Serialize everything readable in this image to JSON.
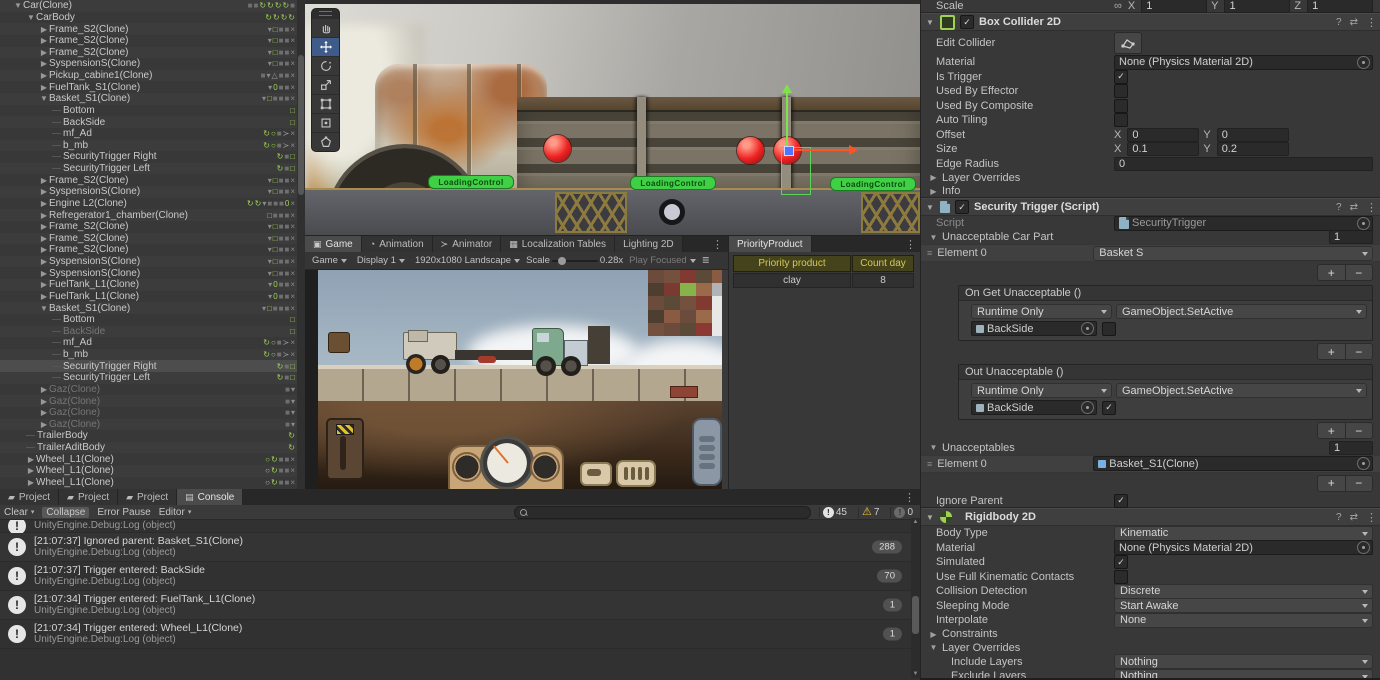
{
  "hierarchy": {
    "items": [
      {
        "label": "Car(Clone)",
        "depth": 1,
        "arrow": "open",
        "state": "normal",
        "badges": [
          "dsq",
          "dsq",
          "gref",
          "gref",
          "gref",
          "gref",
          "dsq"
        ]
      },
      {
        "label": "CarBody",
        "depth": 2,
        "arrow": "open",
        "state": "normal",
        "badges": [
          "gref",
          "gref",
          "gref",
          "gref"
        ]
      },
      {
        "label": "Frame_S2(Clone)",
        "depth": 3,
        "arrow": "closed",
        "state": "normal",
        "badges": [
          "chev",
          "gsq",
          "dsq",
          "dsq",
          "x"
        ]
      },
      {
        "label": "Frame_S2(Clone)",
        "depth": 3,
        "arrow": "closed",
        "state": "normal",
        "badges": [
          "chev",
          "gsq",
          "dsq",
          "dsq",
          "x"
        ]
      },
      {
        "label": "Frame_S2(Clone)",
        "depth": 3,
        "arrow": "closed",
        "state": "normal",
        "badges": [
          "chev",
          "gsq",
          "dsq",
          "dsq",
          "x"
        ]
      },
      {
        "label": "SyspensionS(Clone)",
        "depth": 3,
        "arrow": "closed",
        "state": "normal",
        "badges": [
          "chev",
          "gsq",
          "dsq",
          "dsq",
          "x"
        ]
      },
      {
        "label": "Pickup_cabine1(Clone)",
        "depth": 3,
        "arrow": "closed",
        "state": "normal",
        "badges": [
          "dsq",
          "chev",
          "tri",
          "dsq",
          "dsq",
          "x"
        ]
      },
      {
        "label": "FuelTank_S1(Clone)",
        "depth": 3,
        "arrow": "closed",
        "state": "normal",
        "badges": [
          "chev",
          "gzero",
          "dsq",
          "dsq",
          "x"
        ]
      },
      {
        "label": "Basket_S1(Clone)",
        "depth": 3,
        "arrow": "open",
        "state": "normal",
        "badges": [
          "chev",
          "gsq",
          "dsq",
          "dsq",
          "dsq",
          "x"
        ]
      },
      {
        "label": "Bottom",
        "depth": 4,
        "arrow": "leaf",
        "state": "normal",
        "badges": [
          "gsq"
        ]
      },
      {
        "label": "BackSide",
        "depth": 4,
        "arrow": "leaf",
        "state": "normal",
        "badges": [
          "gsq"
        ]
      },
      {
        "label": "mf_Ad",
        "depth": 4,
        "arrow": "leaf",
        "state": "normal",
        "badges": [
          "gref",
          "gcirc",
          "dsq",
          "prong",
          "x"
        ]
      },
      {
        "label": "b_mb",
        "depth": 4,
        "arrow": "leaf",
        "state": "normal",
        "badges": [
          "gref",
          "gcirc",
          "dsq",
          "prong",
          "x"
        ]
      },
      {
        "label": "SecurityTrigger Right",
        "depth": 4,
        "arrow": "leaf",
        "state": "normal",
        "badges": [
          "gref",
          "dsq",
          "gsq"
        ]
      },
      {
        "label": "SecurityTrigger Left",
        "depth": 4,
        "arrow": "leaf",
        "state": "normal",
        "badges": [
          "gref",
          "dsq",
          "gsq"
        ]
      },
      {
        "label": "Frame_S2(Clone)",
        "depth": 3,
        "arrow": "closed",
        "state": "normal",
        "badges": [
          "chev",
          "gsq",
          "dsq",
          "dsq",
          "x"
        ]
      },
      {
        "label": "SyspensionS(Clone)",
        "depth": 3,
        "arrow": "closed",
        "state": "normal",
        "badges": [
          "chev",
          "gsq",
          "dsq",
          "dsq",
          "x"
        ]
      },
      {
        "label": "Engine L2(Clone)",
        "depth": 3,
        "arrow": "closed",
        "state": "normal",
        "badges": [
          "gref",
          "gref",
          "chev",
          "dsq",
          "dsq",
          "dsq",
          "gzero",
          "x"
        ]
      },
      {
        "label": "Refregerator1_chamber(Clone)",
        "depth": 3,
        "arrow": "closed",
        "state": "normal",
        "badges": [
          "gsq",
          "dsq",
          "dsq",
          "dsq",
          "x"
        ]
      },
      {
        "label": "Frame_S2(Clone)",
        "depth": 3,
        "arrow": "closed",
        "state": "normal",
        "badges": [
          "chev",
          "gsq",
          "dsq",
          "dsq",
          "x"
        ]
      },
      {
        "label": "Frame_S2(Clone)",
        "depth": 3,
        "arrow": "closed",
        "state": "normal",
        "badges": [
          "chev",
          "gsq",
          "dsq",
          "dsq",
          "x"
        ]
      },
      {
        "label": "Frame_S2(Clone)",
        "depth": 3,
        "arrow": "closed",
        "state": "normal",
        "badges": [
          "chev",
          "gsq",
          "dsq",
          "dsq",
          "x"
        ]
      },
      {
        "label": "SyspensionS(Clone)",
        "depth": 3,
        "arrow": "closed",
        "state": "normal",
        "badges": [
          "chev",
          "gsq",
          "dsq",
          "dsq",
          "x"
        ]
      },
      {
        "label": "SyspensionS(Clone)",
        "depth": 3,
        "arrow": "closed",
        "state": "normal",
        "badges": [
          "chev",
          "gsq",
          "dsq",
          "dsq",
          "x"
        ]
      },
      {
        "label": "FuelTank_L1(Clone)",
        "depth": 3,
        "arrow": "closed",
        "state": "normal",
        "badges": [
          "chev",
          "gzero",
          "dsq",
          "dsq",
          "x"
        ]
      },
      {
        "label": "FuelTank_L1(Clone)",
        "depth": 3,
        "arrow": "closed",
        "state": "normal",
        "badges": [
          "chev",
          "gzero",
          "dsq",
          "dsq",
          "x"
        ]
      },
      {
        "label": "Basket_S1(Clone)",
        "depth": 3,
        "arrow": "open",
        "state": "normal",
        "badges": [
          "chev",
          "gsq",
          "dsq",
          "dsq",
          "dsq",
          "x"
        ]
      },
      {
        "label": "Bottom",
        "depth": 4,
        "arrow": "leaf",
        "state": "normal",
        "badges": [
          "gsq"
        ]
      },
      {
        "label": "BackSide",
        "depth": 4,
        "arrow": "leaf",
        "state": "disabled",
        "badges": [
          "gsq"
        ]
      },
      {
        "label": "mf_Ad",
        "depth": 4,
        "arrow": "leaf",
        "state": "normal",
        "badges": [
          "gref",
          "gcirc",
          "dsq",
          "prong",
          "x"
        ]
      },
      {
        "label": "b_mb",
        "depth": 4,
        "arrow": "leaf",
        "state": "normal",
        "badges": [
          "gref",
          "gcirc",
          "dsq",
          "prong",
          "x"
        ]
      },
      {
        "label": "SecurityTrigger Right",
        "depth": 4,
        "arrow": "leaf",
        "state": "selected",
        "badges": [
          "gref",
          "dsq",
          "gsq"
        ]
      },
      {
        "label": "SecurityTrigger Left",
        "depth": 4,
        "arrow": "leaf",
        "state": "normal",
        "badges": [
          "gref",
          "dsq",
          "gsq"
        ]
      },
      {
        "label": "Gaz(Clone)",
        "depth": 3,
        "arrow": "closed",
        "state": "disabled",
        "badges": [
          "dsq",
          "chev"
        ]
      },
      {
        "label": "Gaz(Clone)",
        "depth": 3,
        "arrow": "closed",
        "state": "disabled",
        "badges": [
          "dsq",
          "chev"
        ]
      },
      {
        "label": "Gaz(Clone)",
        "depth": 3,
        "arrow": "closed",
        "state": "disabled",
        "badges": [
          "dsq",
          "chev"
        ]
      },
      {
        "label": "Gaz(Clone)",
        "depth": 3,
        "arrow": "closed",
        "state": "disabled",
        "badges": [
          "dsq",
          "chev"
        ]
      },
      {
        "label": "TrailerBody",
        "depth": 2,
        "arrow": "leaf",
        "state": "normal",
        "badges": [
          "gref"
        ]
      },
      {
        "label": "TrailerAditBody",
        "depth": 2,
        "arrow": "leaf",
        "state": "normal",
        "badges": [
          "gref"
        ]
      },
      {
        "label": "Wheel_L1(Clone)",
        "depth": 2,
        "arrow": "closed",
        "state": "normal",
        "badges": [
          "gcirc",
          "gref",
          "dsq",
          "dsq",
          "x"
        ]
      },
      {
        "label": "Wheel_L1(Clone)",
        "depth": 2,
        "arrow": "closed",
        "state": "normal",
        "badges": [
          "gcirc",
          "gref",
          "dsq",
          "dsq",
          "x"
        ]
      },
      {
        "label": "Wheel_L1(Clone)",
        "depth": 2,
        "arrow": "closed",
        "state": "normal",
        "badges": [
          "gcirc",
          "gref",
          "dsq",
          "dsq",
          "x"
        ]
      }
    ]
  },
  "scene": {
    "labels": [
      "LoadingControl",
      "LoadingControl",
      "LoadingControl"
    ],
    "tools": [
      "hand-tool",
      "move-tool",
      "rotate-tool",
      "scale-tool",
      "rect-tool",
      "transform-tool",
      "edit-collider-tool"
    ],
    "active_tool": "move-tool"
  },
  "game_panel": {
    "tabs": [
      {
        "label": "Game",
        "icon": "game-icon"
      },
      {
        "label": "Animation",
        "icon": "animation-icon"
      },
      {
        "label": "Animator",
        "icon": "animator-icon"
      },
      {
        "label": "Localization Tables",
        "icon": "localization-icon"
      },
      {
        "label": "Lighting 2D",
        "icon": ""
      }
    ],
    "toolbar": {
      "display_mode": "Game",
      "display": "Display 1",
      "resolution": "1920x1080 Landscape",
      "scale_label": "Scale",
      "scale_value": "0.28x",
      "play_focused": "Play Focused"
    }
  },
  "priority_panel": {
    "tab": "PriorityProduct",
    "headers": [
      "Priority product",
      "Count day"
    ],
    "rows": [
      [
        "clay",
        "8"
      ]
    ]
  },
  "console": {
    "tabs": [
      "Project",
      "Project",
      "Project",
      "Console"
    ],
    "toolbar": {
      "clear": "Clear",
      "collapse": "Collapse",
      "error_pause": "Error Pause",
      "editor": "Editor"
    },
    "counts": {
      "info": "45",
      "warning": "7",
      "error": "0"
    },
    "entries": [
      {
        "msg": "",
        "sub": "UnityEngine.Debug:Log (object)",
        "badge": "",
        "partial": true
      },
      {
        "msg": "[21:07:37] Ignored parent: Basket_S1(Clone)",
        "sub": "UnityEngine.Debug:Log (object)",
        "badge": "288"
      },
      {
        "msg": "[21:07:37] Trigger entered: BackSide",
        "sub": "UnityEngine.Debug:Log (object)",
        "badge": "70"
      },
      {
        "msg": "[21:07:34] Trigger entered: FuelTank_L1(Clone)",
        "sub": "UnityEngine.Debug:Log (object)",
        "badge": "1"
      },
      {
        "msg": "[21:07:34] Trigger entered: Wheel_L1(Clone)",
        "sub": "UnityEngine.Debug:Log (object)",
        "badge": "1"
      }
    ]
  },
  "inspector": {
    "scale_row": {
      "label": "Scale",
      "x_label": "X",
      "x": "1",
      "y_label": "Y",
      "y": "1",
      "z_label": "Z",
      "z": "1"
    },
    "box_collider": {
      "title": "Box Collider 2D",
      "edit_collider_label": "Edit Collider",
      "material_label": "Material",
      "material_value": "None (Physics Material 2D)",
      "is_trigger_label": "Is Trigger",
      "used_by_effector_label": "Used By Effector",
      "used_by_composite_label": "Used By Composite",
      "auto_tiling_label": "Auto Tiling",
      "offset_label": "Offset",
      "offset_x": "0",
      "offset_y": "0",
      "size_label": "Size",
      "size_x": "0.1",
      "size_y": "0.2",
      "edge_radius_label": "Edge Radius",
      "edge_radius": "0",
      "layer_overrides_label": "Layer Overrides",
      "info_label": "Info"
    },
    "security_trigger": {
      "title": "Security Trigger (Script)",
      "script_label": "Script",
      "script_value": "SecurityTrigger",
      "unacceptable_label": "Unacceptable Car Part",
      "unacceptable_size": "1",
      "element0_label": "Element 0",
      "element0_value": "Basket S",
      "on_get_label": "On Get Unacceptable ()",
      "out_label": "Out Unacceptable ()",
      "event_mode": "Runtime Only",
      "event_func": "GameObject.SetActive",
      "event_target": "BackSide",
      "unacceptables_label": "Unacceptables",
      "unacceptables_size": "1",
      "unacceptables_elem_label": "Element 0",
      "unacceptables_elem_value": "Basket_S1(Clone)",
      "ignore_parent_label": "Ignore Parent"
    },
    "rigidbody": {
      "title": "Rigidbody 2D",
      "body_type_label": "Body Type",
      "body_type": "Kinematic",
      "material_label": "Material",
      "material_value": "None (Physics Material 2D)",
      "simulated_label": "Simulated",
      "ufkc_label": "Use Full Kinematic Contacts",
      "collision_detection_label": "Collision Detection",
      "collision_detection": "Discrete",
      "sleeping_mode_label": "Sleeping Mode",
      "sleeping_mode": "Start Awake",
      "interpolate_label": "Interpolate",
      "interpolate": "None",
      "constraints_label": "Constraints",
      "layer_overrides_label": "Layer Overrides",
      "include_layers_label": "Include Layers",
      "include_layers": "Nothing",
      "exclude_layers_label": "Exclude Layers",
      "exclude_layers": "Nothing"
    }
  }
}
